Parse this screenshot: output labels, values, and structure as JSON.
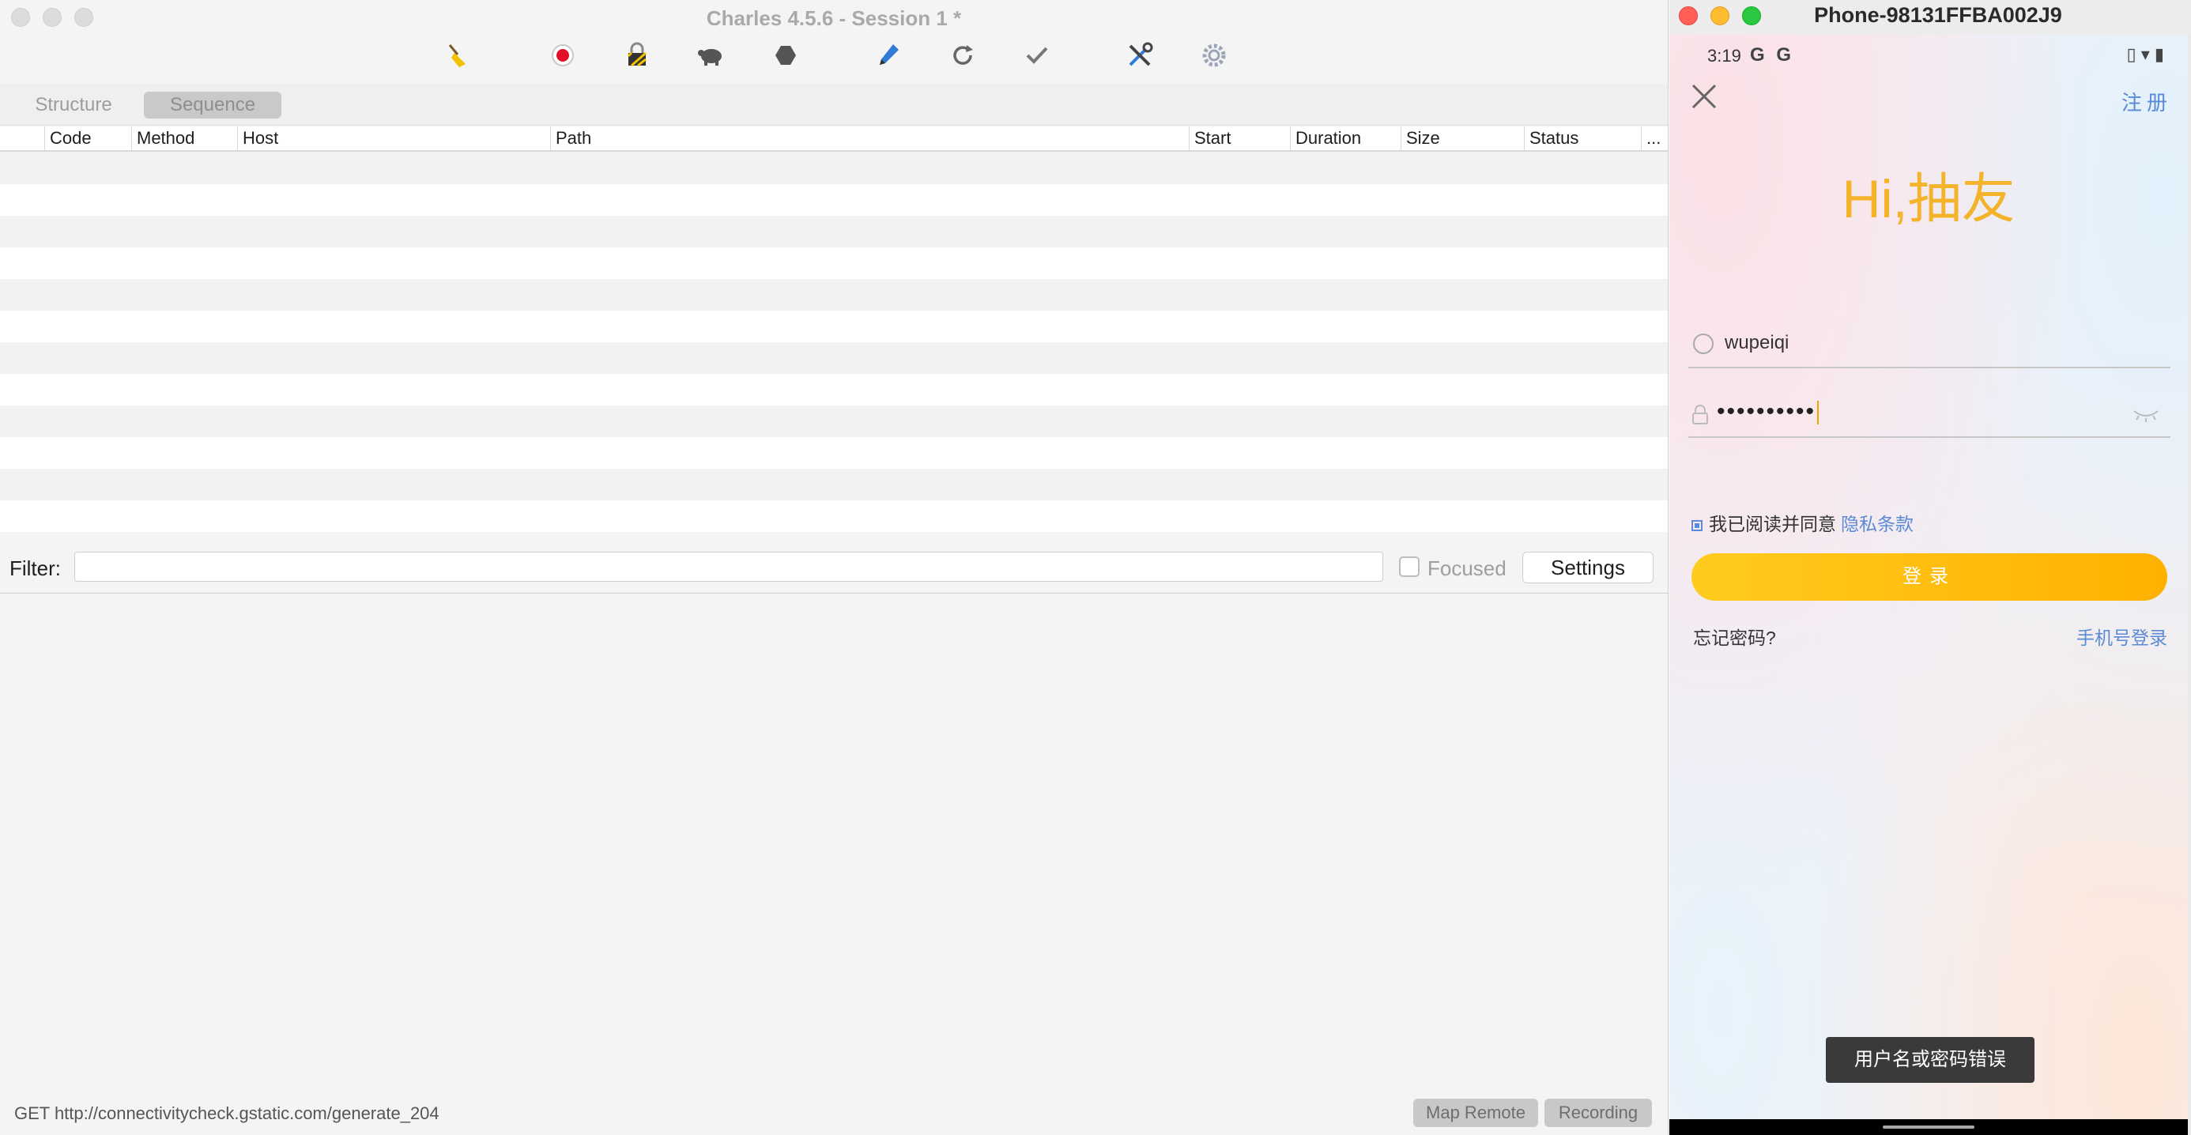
{
  "charles": {
    "window_title": "Charles 4.5.6 - Session 1 *",
    "toolbar_icons": [
      "broom-icon",
      "record-icon",
      "lock-icon",
      "turtle-icon",
      "stop-hexagon-icon",
      "pen-icon",
      "refresh-icon",
      "check-icon",
      "tools-icon",
      "gear-icon"
    ],
    "tabs": [
      {
        "label": "Structure"
      },
      {
        "label": "Sequence",
        "active": true
      }
    ],
    "columns": [
      "Code",
      "Method",
      "Host",
      "Path",
      "Start",
      "Duration",
      "Size",
      "Status",
      "..."
    ],
    "filter": {
      "label": "Filter:",
      "value": "",
      "focused_label": "Focused",
      "settings_label": "Settings"
    },
    "status": {
      "text": "GET http://connectivitycheck.gstatic.com/generate_204",
      "map_remote": "Map Remote",
      "recording": "Recording"
    }
  },
  "phone": {
    "window_title": "Phone-98131FFBA002J9",
    "status_bar": {
      "time": "3:19",
      "icons_left": "G G",
      "icons_right": "▯ ▾ ▮"
    },
    "register": "注册",
    "greeting": "Hi,抽友",
    "username": "wupeiqi",
    "password_mask": "••••••••••",
    "agree_text": "我已阅读并同意",
    "privacy_link": "隐私条款",
    "login_button": "登录",
    "forgot_password": "忘记密码?",
    "phone_login": "手机号登录",
    "toast": "用户名或密码错误"
  }
}
